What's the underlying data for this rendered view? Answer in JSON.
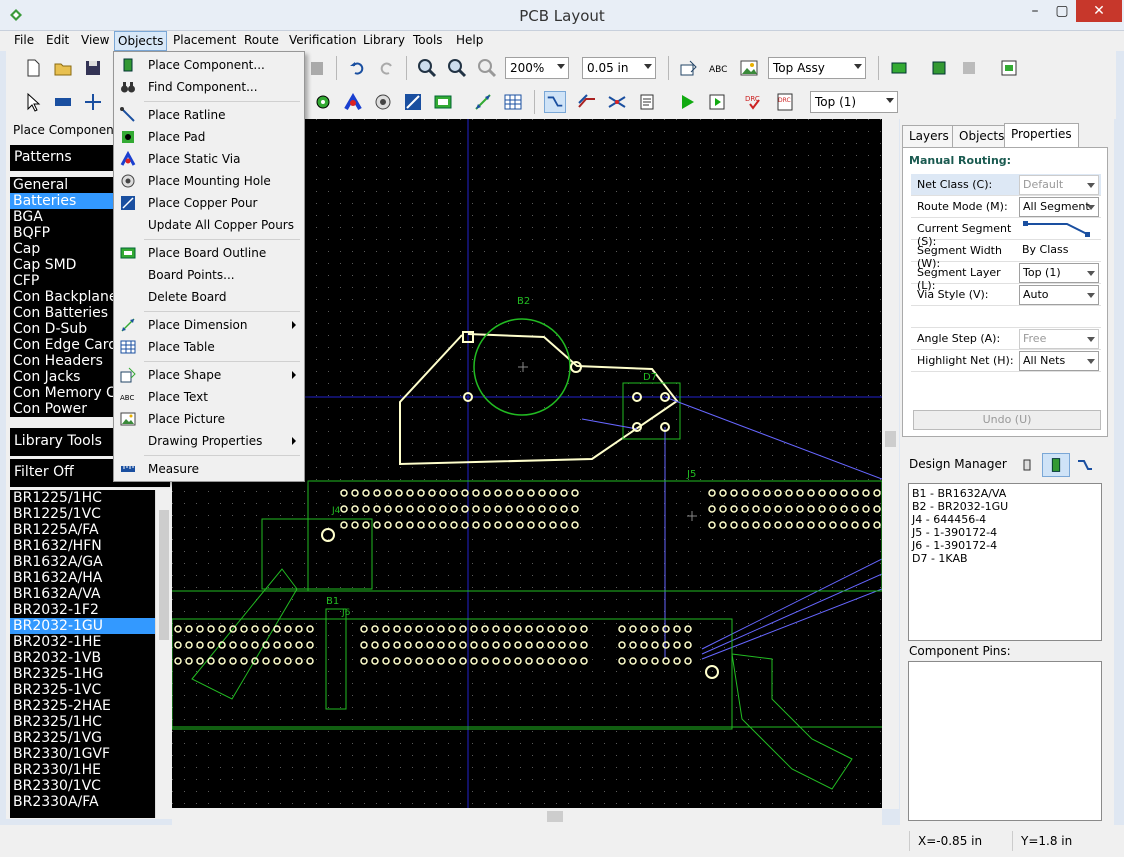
{
  "window": {
    "title": "PCB Layout",
    "controls": [
      "–",
      "▢",
      "✕"
    ]
  },
  "menubar": [
    "File",
    "Edit",
    "View",
    "Objects",
    "Placement",
    "Route",
    "Verification",
    "Library",
    "Tools",
    "Help"
  ],
  "toolbar": {
    "zoom": "200%",
    "grid": "0.05 in",
    "view": "Top Assy",
    "layer": "Top (1)"
  },
  "left": {
    "place_component": "Place Component",
    "patterns_header": "Patterns",
    "patterns": [
      "General",
      "Batteries",
      "BGA",
      "BQFP",
      "Cap",
      "Cap SMD",
      "CFP",
      "Con Backplane",
      "Con Batteries",
      "Con D-Sub",
      "Con Edge Card",
      "Con Headers",
      "Con Jacks",
      "Con Memory C",
      "Con Power"
    ],
    "patterns_selected": "Batteries",
    "library_tools": "Library Tools",
    "filter": "Filter Off",
    "parts": [
      "BR1225/1HC",
      "BR1225/1VC",
      "BR1225A/FA",
      "BR1632/HFN",
      "BR1632A/GA",
      "BR1632A/HA",
      "BR1632A/VA",
      "BR2032-1F2",
      "BR2032-1GU",
      "BR2032-1HE",
      "BR2032-1VB",
      "BR2325-1HG",
      "BR2325-1VC",
      "BR2325-2HAE",
      "BR2325/1HC",
      "BR2325/1VG",
      "BR2330/1GVF",
      "BR2330/1HE",
      "BR2330/1VC",
      "BR2330A/FA"
    ],
    "parts_selected": "BR2032-1GU"
  },
  "canvas_labels": {
    "b2": "B2",
    "d7": "D7",
    "j5": "J5",
    "j4": "J4",
    "b1": "B1",
    "j6": "J6"
  },
  "objects_menu": [
    {
      "label": "Place Component...",
      "icon": "chip-icon",
      "sub": false
    },
    {
      "label": "Find Component...",
      "icon": "binoculars-icon",
      "sub": false
    },
    {
      "sep": true
    },
    {
      "label": "Place Ratline",
      "icon": "ratline-icon",
      "sub": false
    },
    {
      "label": "Place Pad",
      "icon": "pad-icon",
      "sub": false
    },
    {
      "label": "Place Static Via",
      "icon": "via-icon",
      "sub": false
    },
    {
      "label": "Place Mounting Hole",
      "icon": "mounting-hole-icon",
      "sub": false
    },
    {
      "label": "Place Copper Pour",
      "icon": "copper-pour-icon",
      "sub": false
    },
    {
      "label": "Update All Copper Pours",
      "icon": "",
      "sub": false
    },
    {
      "sep": true
    },
    {
      "label": "Place Board Outline",
      "icon": "board-outline-icon",
      "sub": false
    },
    {
      "label": "Board Points...",
      "icon": "",
      "sub": false
    },
    {
      "label": "Delete Board",
      "icon": "",
      "sub": false
    },
    {
      "sep": true
    },
    {
      "label": "Place Dimension",
      "icon": "dimension-icon",
      "sub": true
    },
    {
      "label": "Place Table",
      "icon": "table-icon",
      "sub": false
    },
    {
      "sep": true
    },
    {
      "label": "Place Shape",
      "icon": "shape-icon",
      "sub": true
    },
    {
      "label": "Place Text",
      "icon": "text-icon",
      "sub": false
    },
    {
      "label": "Place Picture",
      "icon": "picture-icon",
      "sub": false
    },
    {
      "label": "Drawing Properties",
      "icon": "",
      "sub": true
    },
    {
      "sep": true
    },
    {
      "label": "Measure",
      "icon": "measure-icon",
      "sub": false
    }
  ],
  "right": {
    "tabs": [
      "Layers",
      "Objects",
      "Properties"
    ],
    "active_tab": "Properties",
    "section": "Manual Routing:",
    "props": [
      {
        "label": "Net Class (C):",
        "value": "Default",
        "disabled": true,
        "combo": true
      },
      {
        "label": "Route Mode (M):",
        "value": "All Segment",
        "disabled": false,
        "combo": true
      },
      {
        "label": "Current Segment (S):",
        "value": "",
        "disabled": false,
        "combo": false
      },
      {
        "label": "Segment Width (W):",
        "value": "By Class",
        "disabled": false,
        "combo": false
      },
      {
        "label": "Segment Layer (L):",
        "value": "Top (1)",
        "disabled": false,
        "combo": true
      },
      {
        "label": "Via Style (V):",
        "value": "Auto",
        "disabled": false,
        "combo": true
      },
      {
        "label": "",
        "value": "",
        "disabled": false,
        "combo": false
      },
      {
        "label": "Angle Step (A):",
        "value": "Free",
        "disabled": true,
        "combo": true
      },
      {
        "label": "Highlight Net (H):",
        "value": "All Nets",
        "disabled": false,
        "combo": true
      }
    ],
    "undo": "Undo (U)",
    "design_manager": "Design Manager",
    "dm_items": [
      "B1 - BR1632A/VA",
      "B2 - BR2032-1GU",
      "J4 - 644456-4",
      "J5 - 1-390172-4",
      "J6 - 1-390172-4",
      "D7 - 1KAB"
    ],
    "component_pins": "Component Pins:"
  },
  "status": {
    "x": "X=-0.85 in",
    "y": "Y=1.8 in"
  },
  "colors": {
    "board": "#000000",
    "outline": "#ffffcc",
    "copper_green": "#22bb22",
    "ratline": "#6666ff",
    "pad": "#ffffcc",
    "selection": "#3399ff"
  }
}
